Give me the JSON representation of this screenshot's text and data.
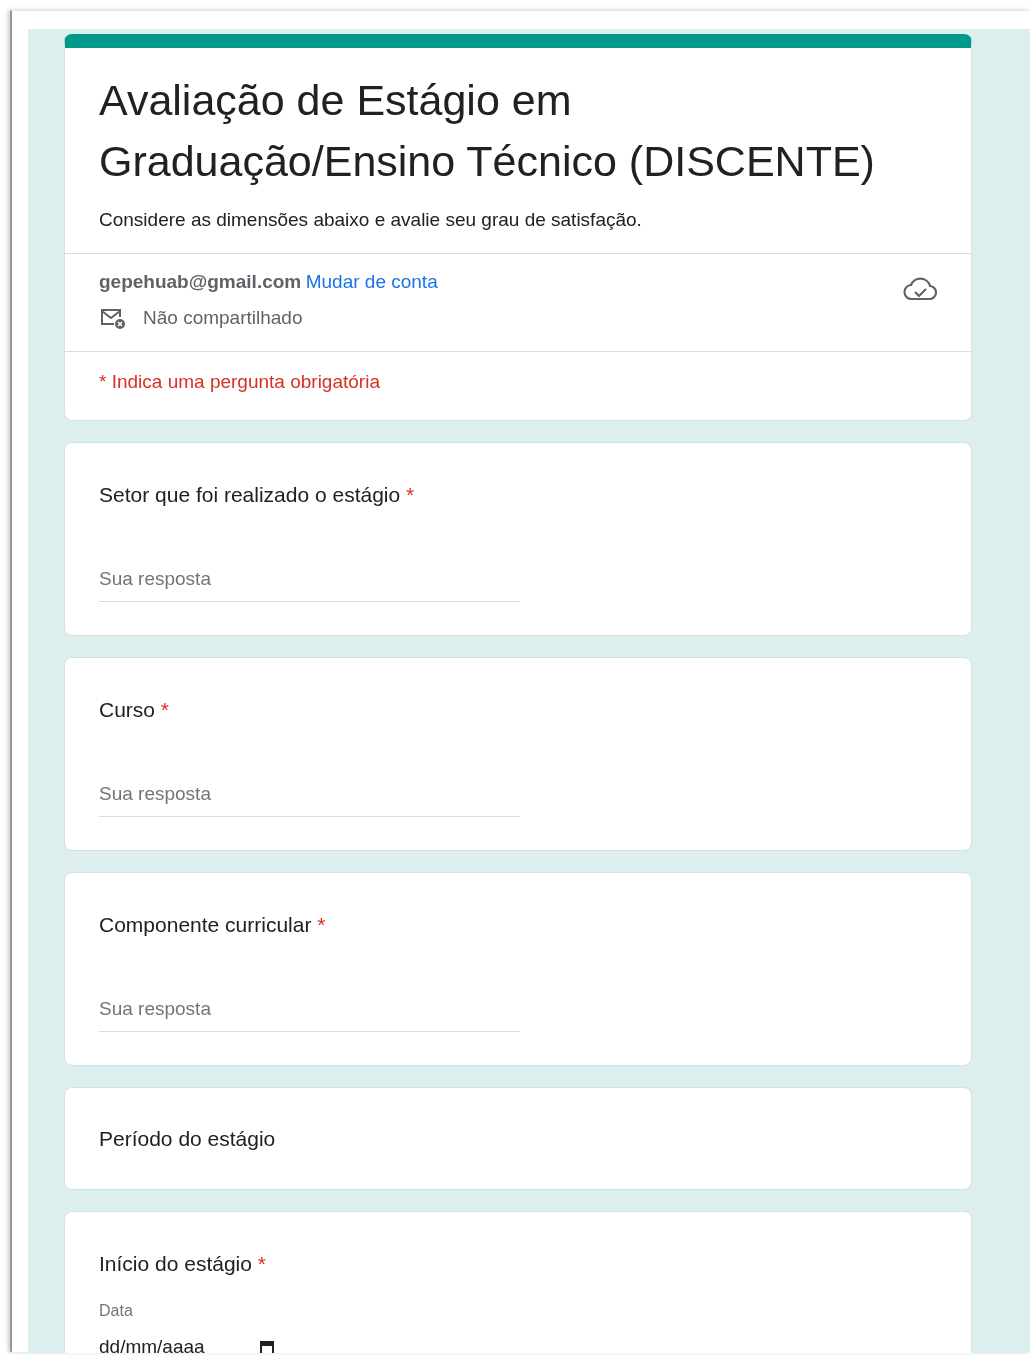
{
  "form": {
    "title": "Avaliação de Estágio em Graduação/Ensino Técnico (DISCENTE)",
    "description": "Considere as dimensões abaixo e avalie seu grau de satisfação.",
    "account": {
      "email": "gepehuab@gmail.com",
      "switch_link": "Mudar de conta",
      "sharing": "Não compartilhado"
    },
    "required_note": "* Indica uma pergunta obrigatória"
  },
  "required_symbol": "*",
  "questions": [
    {
      "kind": "text",
      "label": "Setor que foi realizado o estágio",
      "required": true,
      "placeholder": "Sua resposta"
    },
    {
      "kind": "text",
      "label": "Curso",
      "required": true,
      "placeholder": "Sua resposta"
    },
    {
      "kind": "text",
      "label": "Componente curricular",
      "required": true,
      "placeholder": "Sua resposta"
    },
    {
      "kind": "section",
      "label": "Período do estágio",
      "required": false
    },
    {
      "kind": "date",
      "label": "Início do estágio",
      "required": true,
      "sublabel": "Data",
      "placeholder": "dd/mm/aaaa"
    }
  ]
}
